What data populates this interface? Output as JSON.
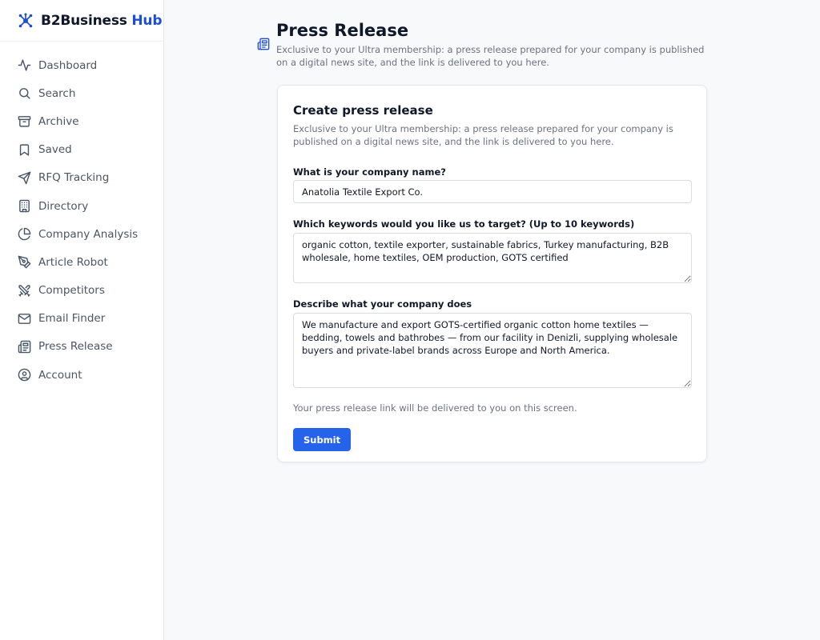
{
  "brand": {
    "name": "B2Business",
    "accent": "Hub",
    "icon": "hub-network-icon"
  },
  "sidebar": {
    "items": [
      {
        "label": "Dashboard",
        "icon": "activity-icon"
      },
      {
        "label": "Search",
        "icon": "search-icon"
      },
      {
        "label": "Archive",
        "icon": "archive-box-icon"
      },
      {
        "label": "Saved",
        "icon": "bookmark-icon"
      },
      {
        "label": "RFQ Tracking",
        "icon": "send-icon"
      },
      {
        "label": "Directory",
        "icon": "building-icon"
      },
      {
        "label": "Company Analysis",
        "icon": "pie-chart-icon"
      },
      {
        "label": "Article Robot",
        "icon": "pen-nib-icon"
      },
      {
        "label": "Competitors",
        "icon": "crossed-swords-icon"
      },
      {
        "label": "Email Finder",
        "icon": "mail-icon"
      },
      {
        "label": "Press Release",
        "icon": "newspaper-icon"
      },
      {
        "label": "Account",
        "icon": "user-circle-icon"
      }
    ]
  },
  "page": {
    "title": "Press Release",
    "subtitle": "Exclusive to your Ultra membership: a press release prepared for your company is published on a digital news site, and the link is delivered to you here.",
    "icon": "newspaper-icon"
  },
  "form": {
    "title": "Create press release",
    "description": "Exclusive to your Ultra membership: a press release prepared for your company is published on a digital news site, and the link is delivered to you here.",
    "company_label": "What is your company name?",
    "company_value": "Anatolia Textile Export Co.",
    "keywords_label": "Which keywords would you like us to target? (Up to 10 keywords)",
    "keywords_value": "organic cotton, textile exporter, sustainable fabrics, Turkey manufacturing, B2B wholesale, home textiles, OEM production, GOTS certified",
    "description_label": "Describe what your company does",
    "description_value": "We manufacture and export GOTS-certified organic cotton home textiles — bedding, towels and bathrobes — from our facility in Denizli, supplying wholesale buyers and private-label brands across Europe and North America.",
    "hint": "Your press release link will be delivered to you on this screen.",
    "submit_label": "Submit"
  },
  "colors": {
    "accent": "#2563eb",
    "brand_accent": "#1d4ed8",
    "sidebar_bg": "#ffffff",
    "page_bg": "#f8f9fb"
  }
}
